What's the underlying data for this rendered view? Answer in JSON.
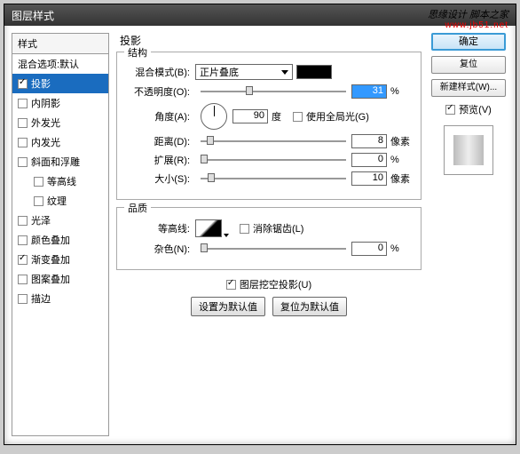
{
  "title": "图层样式",
  "watermark": "思缘设计 脚本之家",
  "watermark_url": "www.jb51.net",
  "sidebar": {
    "header": "样式",
    "items": [
      {
        "label": "混合选项:默认",
        "checked": false,
        "nobox": true
      },
      {
        "label": "投影",
        "checked": true,
        "selected": true
      },
      {
        "label": "内阴影",
        "checked": false
      },
      {
        "label": "外发光",
        "checked": false
      },
      {
        "label": "内发光",
        "checked": false
      },
      {
        "label": "斜面和浮雕",
        "checked": false
      },
      {
        "label": "等高线",
        "checked": false,
        "indent": true
      },
      {
        "label": "纹理",
        "checked": false,
        "indent": true
      },
      {
        "label": "光泽",
        "checked": false
      },
      {
        "label": "颜色叠加",
        "checked": false
      },
      {
        "label": "渐变叠加",
        "checked": true
      },
      {
        "label": "图案叠加",
        "checked": false
      },
      {
        "label": "描边",
        "checked": false
      }
    ]
  },
  "main": {
    "title": "投影",
    "structure": {
      "legend": "结构",
      "blend_mode_label": "混合模式(B):",
      "blend_mode_value": "正片叠底",
      "opacity_label": "不透明度(O):",
      "opacity_value": "31",
      "opacity_unit": "%",
      "angle_label": "角度(A):",
      "angle_value": "90",
      "angle_unit": "度",
      "global_light_label": "使用全局光(G)",
      "distance_label": "距离(D):",
      "distance_value": "8",
      "distance_unit": "像素",
      "spread_label": "扩展(R):",
      "spread_value": "0",
      "spread_unit": "%",
      "size_label": "大小(S):",
      "size_value": "10",
      "size_unit": "像素"
    },
    "quality": {
      "legend": "品质",
      "contour_label": "等高线:",
      "antialias_label": "消除锯齿(L)",
      "noise_label": "杂色(N):",
      "noise_value": "0",
      "noise_unit": "%"
    },
    "knockout_label": "图层挖空投影(U)",
    "set_default": "设置为默认值",
    "reset_default": "复位为默认值"
  },
  "right": {
    "ok": "确定",
    "cancel": "复位",
    "new_style": "新建样式(W)...",
    "preview_label": "预览(V)"
  }
}
